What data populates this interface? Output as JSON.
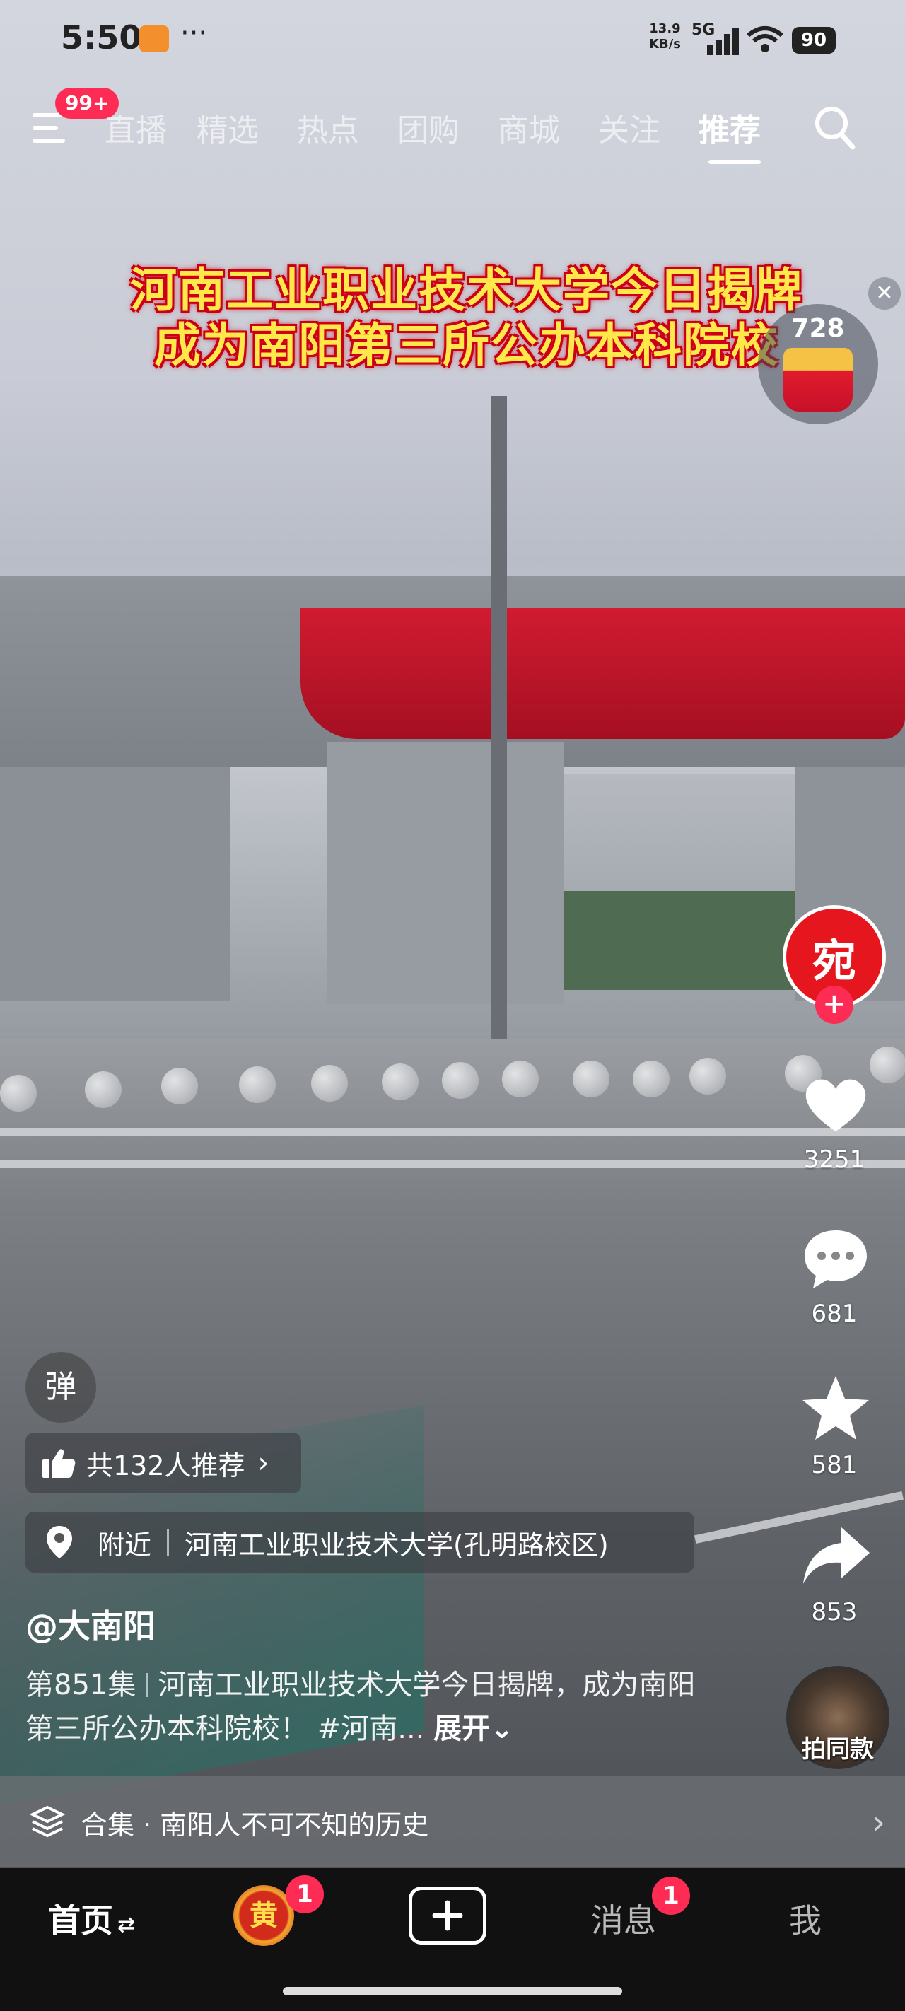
{
  "status_bar": {
    "time": "5:50",
    "net_speed_value": "13.9",
    "net_speed_unit": "KB/s",
    "network_type": "5G",
    "battery": "90"
  },
  "top_nav": {
    "notification_badge": "99+",
    "tabs": [
      {
        "label": "直播"
      },
      {
        "label": "精选"
      },
      {
        "label": "热点"
      },
      {
        "label": "团购"
      },
      {
        "label": "商城"
      },
      {
        "label": "关注"
      },
      {
        "label": "推荐",
        "active": true
      }
    ]
  },
  "video": {
    "headline_line1": "河南工业职业技术大学今日揭牌",
    "headline_line2": "成为南阳第三所公办本科院校"
  },
  "coin_widget": {
    "count": "728"
  },
  "creator_avatar": {
    "glyph": "宛"
  },
  "actions": {
    "likes": "3251",
    "comments": "681",
    "favorites": "581",
    "shares": "853",
    "same_style_label": "拍同款"
  },
  "overlay": {
    "danmu_label": "弹",
    "recommend_text": "共132人推荐",
    "location_tag": "附近",
    "location_name": "河南工业职业技术大学(孔明路校区)",
    "author": "@大南阳",
    "episode": "第851集",
    "description": "河南工业职业技术大学今日揭牌，成为南阳第三所公办本科院校！ #河南...",
    "expand_label": "展开"
  },
  "collection": {
    "label": "合集 · 南阳人不可不知的历史"
  },
  "bottom_nav": {
    "home": "首页",
    "center_avatar_glyph": "黄",
    "center_badge": "1",
    "messages": "消息",
    "messages_badge": "1",
    "me": "我"
  },
  "colors": {
    "accent_red": "#fe2c55",
    "headline_yellow": "#ffe94a",
    "headline_outline": "#c20015"
  }
}
